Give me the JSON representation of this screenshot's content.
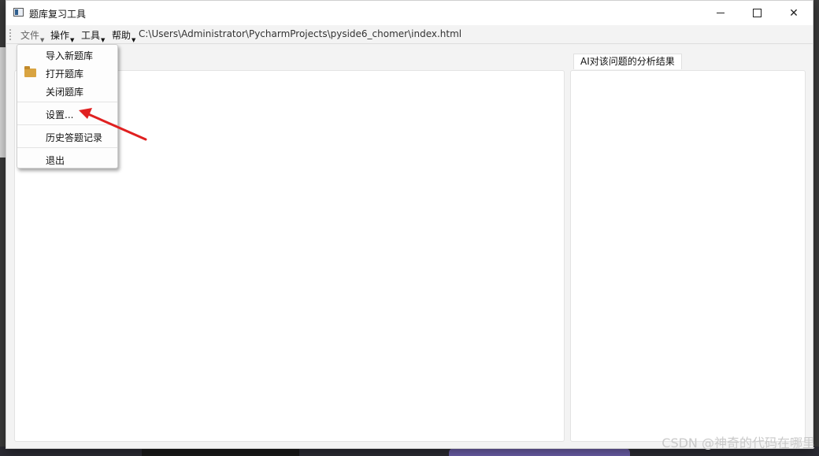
{
  "window": {
    "title": "题库复习工具"
  },
  "toolbar": {
    "file_label": "文件",
    "ops_label": "操作",
    "tools_label": "工具",
    "help_label": "帮助",
    "path": "C:\\Users\\Administrator\\PycharmProjects\\pyside6_chomer\\index.html"
  },
  "file_menu": {
    "items": [
      {
        "label": "导入新题库"
      },
      {
        "label": "打开题库",
        "icon": "folder-icon"
      },
      {
        "label": "关闭题库"
      },
      {
        "label": "设置..."
      },
      {
        "label": "历史答题记录"
      },
      {
        "label": "退出"
      }
    ]
  },
  "right_panel": {
    "tab_label": "AI对该问题的分析结果"
  },
  "watermark": "CSDN @神奇的代码在哪里",
  "colors": {
    "annotation_arrow": "#e02020",
    "window_bg": "#f3f3f3",
    "panel_bg": "#ffffff"
  }
}
